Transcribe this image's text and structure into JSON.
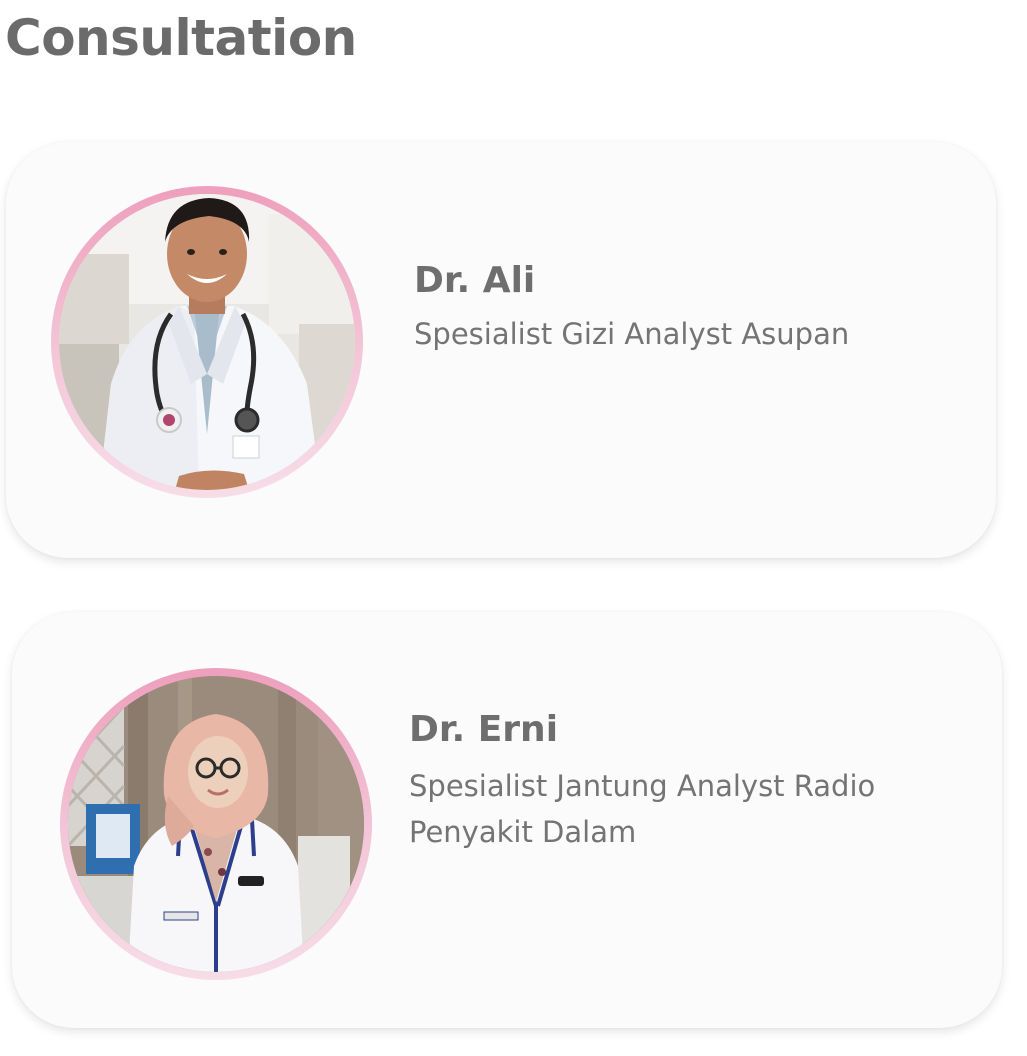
{
  "page": {
    "title": "Consultation"
  },
  "theme": {
    "title_color": "#6b6b6b",
    "card_background": "#fbfbfb",
    "avatar_ring_color": "#ee9fbc",
    "text_color": "#747474"
  },
  "doctors": [
    {
      "name": "Dr. Ali",
      "specialty": "Spesialist Gizi Analyst Asupan",
      "avatar": "doctor-photo-male"
    },
    {
      "name": "Dr. Erni",
      "specialty": "Spesialist Jantung Analyst Radio Penyakit Dalam",
      "avatar": "doctor-photo-female"
    }
  ]
}
